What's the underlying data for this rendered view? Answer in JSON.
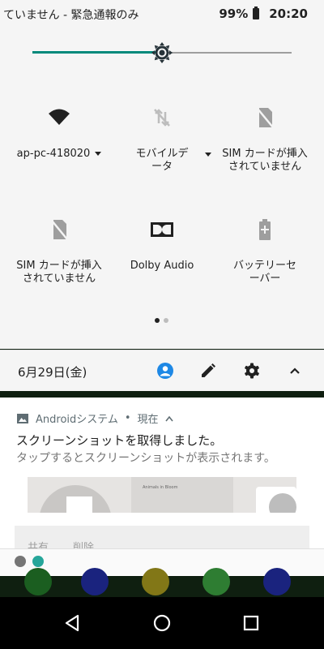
{
  "status_bar": {
    "carrier_text": "ていません - 緊急通報のみ",
    "battery_percent": "99%",
    "time": "20:20"
  },
  "brightness": {
    "level_fraction": 0.5,
    "accent_color": "#00897b"
  },
  "quick_tiles": [
    {
      "id": "wifi",
      "label": "ap-pc-418020",
      "icon": "wifi-icon",
      "has_dropdown": true
    },
    {
      "id": "mobile-data",
      "label_line1": "モバイルデ",
      "label_line2": "ータ",
      "icon": "mobile-data-off-icon",
      "has_dropdown": true
    },
    {
      "id": "sim1",
      "label_line1": "SIM カードが挿入",
      "label_line2": "されていません",
      "icon": "sim-missing-icon"
    },
    {
      "id": "sim2",
      "label_line1": "SIM カードが挿入",
      "label_line2": "されていません",
      "icon": "sim-missing-icon"
    },
    {
      "id": "dolby",
      "label": "Dolby Audio",
      "icon": "dolby-icon"
    },
    {
      "id": "battery-saver",
      "label_line1": "バッテリーセ",
      "label_line2": "ーバー",
      "icon": "battery-saver-icon"
    }
  ],
  "page_dots": {
    "count": 2,
    "active_index": 0
  },
  "footer": {
    "date": "6月29日(金)",
    "icons": [
      "user-icon",
      "edit-icon",
      "settings-icon",
      "collapse-icon"
    ],
    "user_icon_color": "#1e88e5"
  },
  "notification": {
    "app_name": "Androidシステム",
    "separator": "•",
    "when": "現在",
    "title": "スクリーンショットを取得しました。",
    "text": "タップするとスクリーンショットが表示されます。",
    "thumb_caption": "Animals in Bloom",
    "actions": [
      "共有",
      "削除"
    ],
    "accent_color": "#5f6d73"
  }
}
